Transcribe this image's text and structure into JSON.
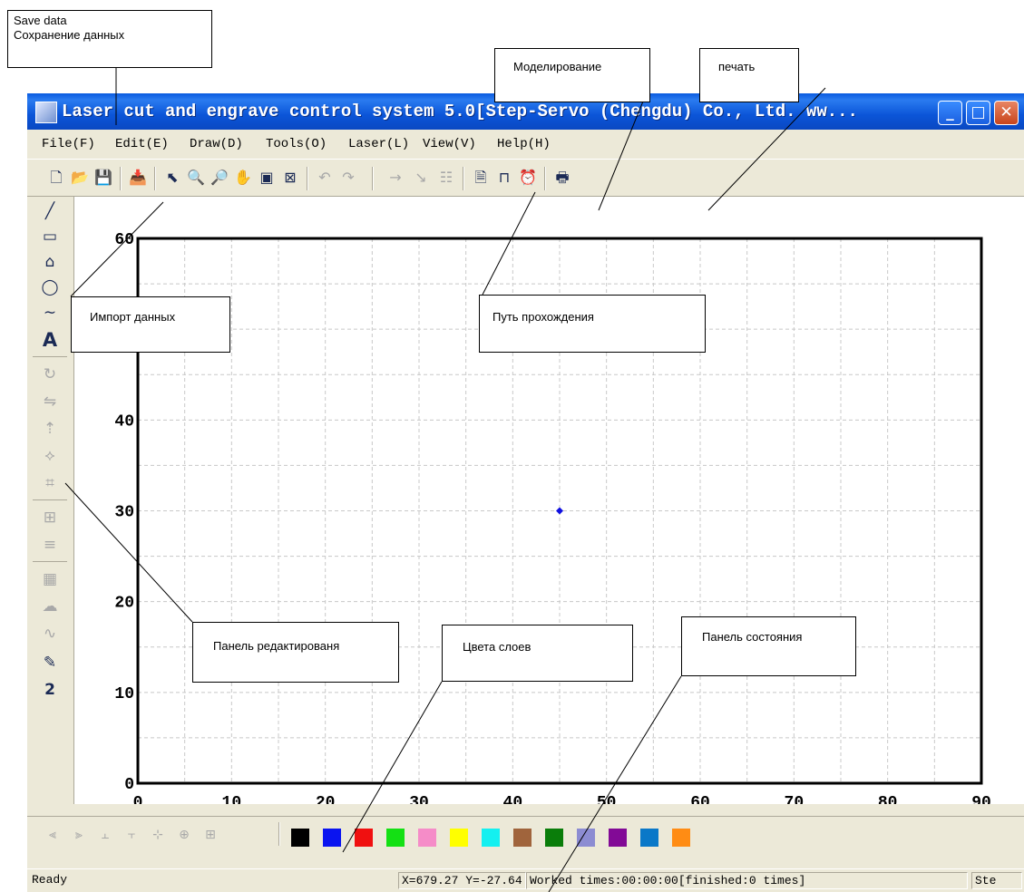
{
  "window": {
    "title": "Laser cut and engrave control system 5.0[Step-Servo (Chengdu) Co., Ltd. ww...",
    "controls": {
      "minimize": "_",
      "maximize": "□",
      "close": "✕"
    }
  },
  "menu": [
    "File(F)",
    "Edit(E)",
    "Draw(D)",
    "Tools(O)",
    "Laser(L)",
    "View(V)",
    "Help(H)"
  ],
  "toolbar": {
    "buttons": [
      {
        "name": "new-file-icon",
        "glyph": "🗋"
      },
      {
        "name": "open-folder-icon",
        "glyph": "📂"
      },
      {
        "name": "save-icon",
        "glyph": "💾"
      },
      {
        "name": "import-icon",
        "glyph": "📥"
      },
      {
        "name": "select-arrow-icon",
        "glyph": "⬉"
      },
      {
        "name": "zoom-in-icon",
        "glyph": "🔍"
      },
      {
        "name": "zoom-out-icon",
        "glyph": "🔎"
      },
      {
        "name": "hand-pan-icon",
        "glyph": "✋"
      },
      {
        "name": "page-view-icon",
        "glyph": "▣"
      },
      {
        "name": "fit-view-icon",
        "glyph": "⊠"
      },
      {
        "name": "undo-icon",
        "glyph": "↶"
      },
      {
        "name": "redo-icon",
        "glyph": "↷"
      },
      {
        "name": "simulate-icon",
        "glyph": "→"
      },
      {
        "name": "path-icon",
        "glyph": "↘"
      },
      {
        "name": "path-order-icon",
        "glyph": "☷"
      },
      {
        "name": "preview-icon",
        "glyph": "🗎"
      },
      {
        "name": "bench-icon",
        "glyph": "⊓"
      },
      {
        "name": "timer-icon",
        "glyph": "⏰"
      },
      {
        "name": "print-icon",
        "glyph": "🖶"
      }
    ]
  },
  "left_tools": [
    {
      "name": "line-tool-icon",
      "glyph": "╱"
    },
    {
      "name": "rectangle-tool-icon",
      "glyph": "▭"
    },
    {
      "name": "polyline-tool-icon",
      "glyph": "⌂"
    },
    {
      "name": "ellipse-tool-icon",
      "glyph": "◯"
    },
    {
      "name": "curve-tool-icon",
      "glyph": "∼"
    },
    {
      "name": "text-tool-icon",
      "glyph": "A"
    },
    {
      "name": "rotate-tool-icon",
      "glyph": "↻"
    },
    {
      "name": "mirror-tool-icon",
      "glyph": "⇋"
    },
    {
      "name": "align-tool-icon",
      "glyph": "⇡"
    },
    {
      "name": "node-edit-tool-icon",
      "glyph": "⟡"
    },
    {
      "name": "crop-tool-icon",
      "glyph": "⌗"
    },
    {
      "name": "array-tool-icon",
      "glyph": "⊞"
    },
    {
      "name": "fill-lines-tool-icon",
      "glyph": "≡"
    },
    {
      "name": "grating-tool-icon",
      "glyph": "▦"
    },
    {
      "name": "stamp-tool-icon",
      "glyph": "☁"
    },
    {
      "name": "smooth-tool-icon",
      "glyph": "∿"
    },
    {
      "name": "laser-pen-tool-icon",
      "glyph": "✎"
    },
    {
      "name": "order-tool-icon",
      "glyph": "2"
    }
  ],
  "chart_data": {
    "type": "scatter",
    "xlim": [
      0,
      90
    ],
    "ylim": [
      0,
      60
    ],
    "x_ticks": [
      "0",
      "10",
      "20",
      "30",
      "40",
      "50",
      "60",
      "70",
      "80",
      "90"
    ],
    "y_ticks": [
      "0",
      "10",
      "20",
      "30",
      "40",
      "60"
    ],
    "grid": true,
    "points": [
      {
        "x": 45,
        "y": 30
      }
    ],
    "point_color": "#1010e0"
  },
  "bottom_tools": [
    {
      "name": "align-left-icon",
      "glyph": "⫷"
    },
    {
      "name": "align-right-icon",
      "glyph": "⫸"
    },
    {
      "name": "align-top-icon",
      "glyph": "⫠"
    },
    {
      "name": "align-bottom-icon",
      "glyph": "⫟"
    },
    {
      "name": "center-horizontal-icon",
      "glyph": "⊹"
    },
    {
      "name": "center-vertical-icon",
      "glyph": "⊕"
    },
    {
      "name": "center-both-icon",
      "glyph": "⊞"
    }
  ],
  "layer_colors": [
    "#000000",
    "#0a14f0",
    "#f01010",
    "#14e014",
    "#f58cc8",
    "#ffff00",
    "#14f0f0",
    "#a0643c",
    "#0a7d0a",
    "#8c8cd2",
    "#820a96",
    "#0a78c8",
    "#ff8c14"
  ],
  "status": {
    "ready": "Ready",
    "coords": "X=679.27 Y=-27.64",
    "worked": "Worked times:00:00:00[finished:0 times]",
    "extra": "Ste"
  },
  "callouts": [
    {
      "name": "callout-save-data",
      "lines": [
        "Save data",
        "Сохранение данных"
      ]
    },
    {
      "name": "callout-modeling",
      "lines": [
        "Моделирование"
      ]
    },
    {
      "name": "callout-print",
      "lines": [
        "печать"
      ]
    },
    {
      "name": "callout-import",
      "lines": [
        "Импорт данных"
      ]
    },
    {
      "name": "callout-path",
      "lines": [
        "Путь прохождения"
      ]
    },
    {
      "name": "callout-edit-panel",
      "lines": [
        "Панель редактированя"
      ]
    },
    {
      "name": "callout-layer-colors",
      "lines": [
        "Цвета слоев"
      ]
    },
    {
      "name": "callout-status-panel",
      "lines": [
        "Панель состояния"
      ]
    }
  ]
}
